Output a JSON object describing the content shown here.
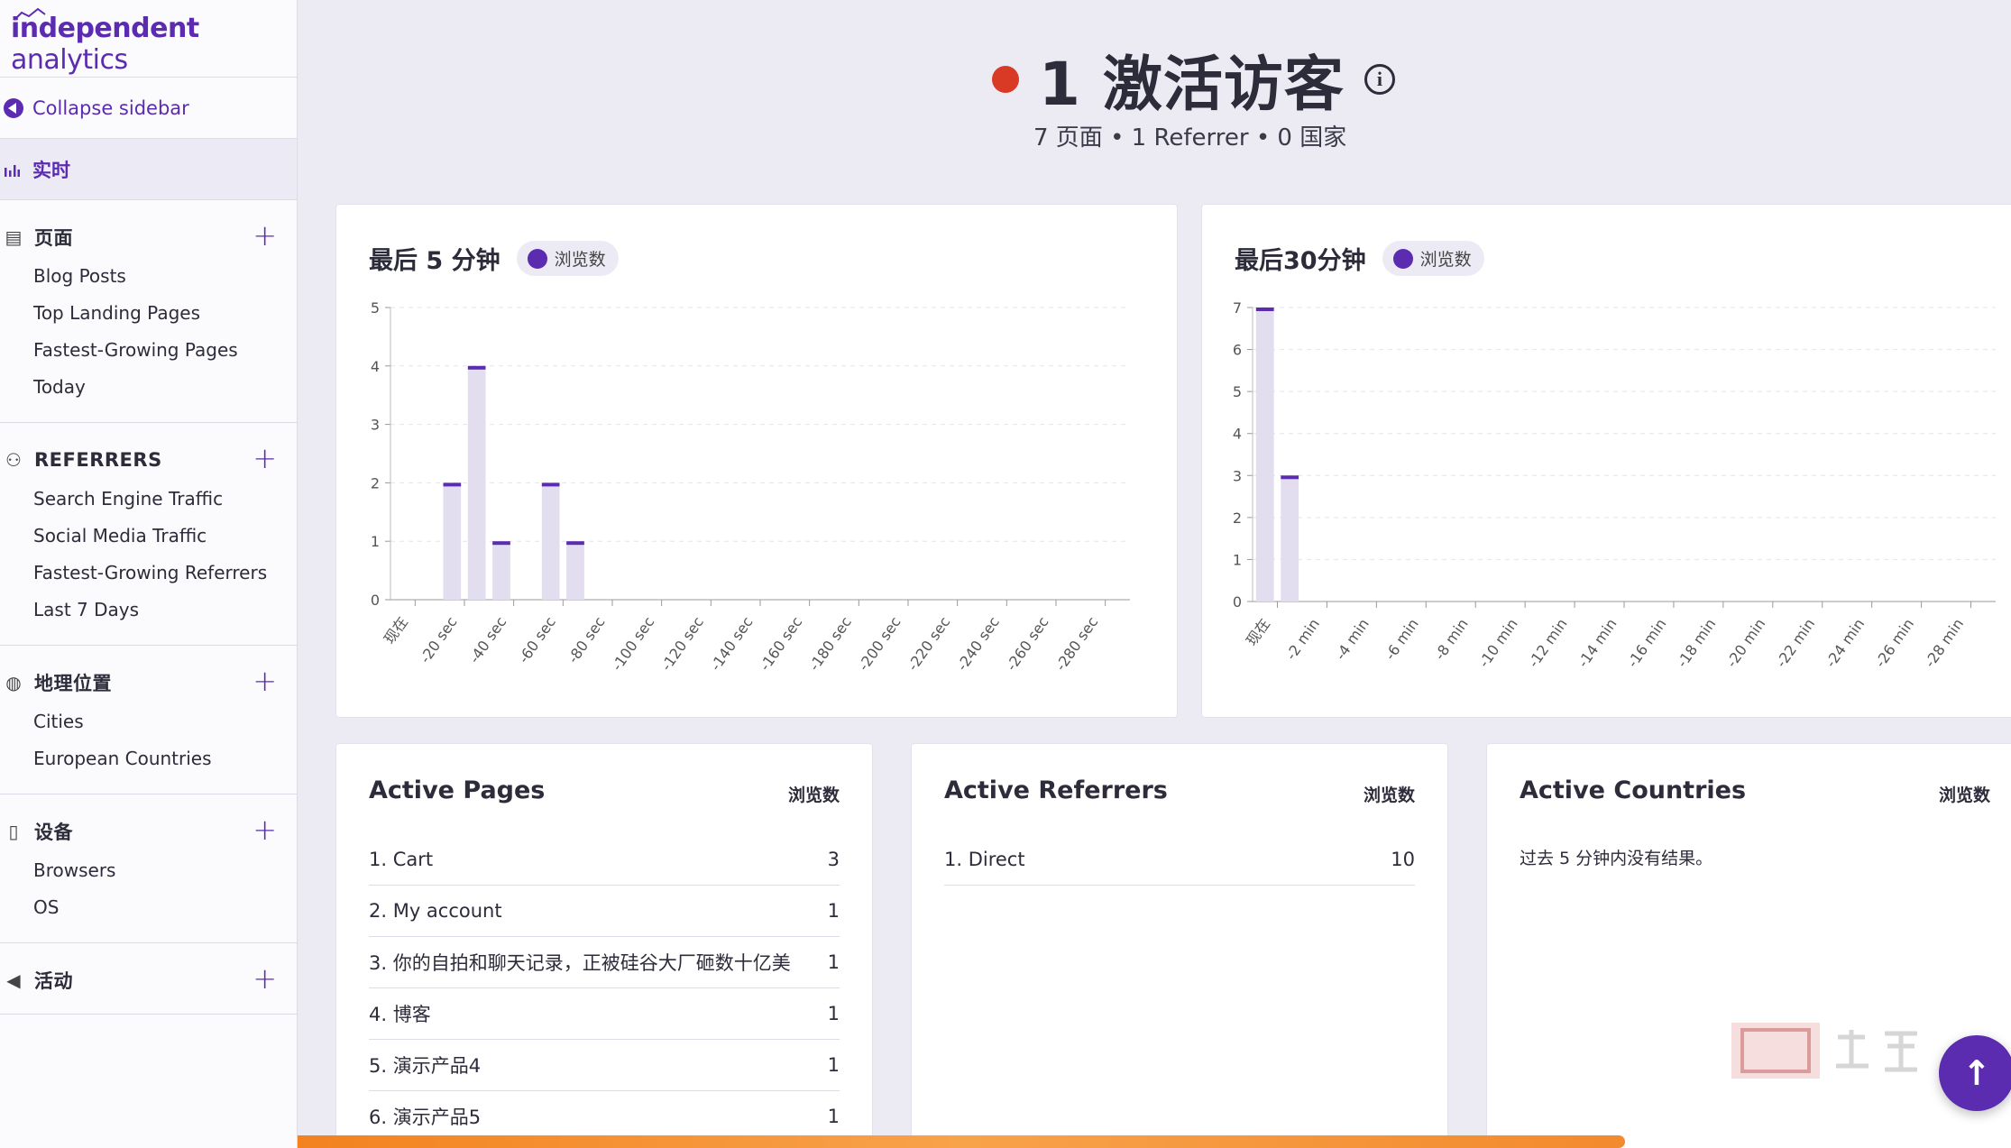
{
  "sidebar": {
    "logo": {
      "part1": "independent",
      "part2": " analytics"
    },
    "collapse_label": "Collapse sidebar",
    "realtime_label": "实时",
    "sections": [
      {
        "icon": "page-icon",
        "label": "页面",
        "items": [
          "Blog Posts",
          "Top Landing Pages",
          "Fastest-Growing Pages",
          "Today"
        ]
      },
      {
        "icon": "network-icon",
        "label": "REFERRERS",
        "items": [
          "Search Engine Traffic",
          "Social Media Traffic",
          "Fastest-Growing Referrers",
          "Last 7 Days"
        ]
      },
      {
        "icon": "globe-icon",
        "label": "地理位置",
        "items": [
          "Cities",
          "European Countries"
        ]
      },
      {
        "icon": "device-icon",
        "label": "设备",
        "items": [
          "Browsers",
          "OS"
        ]
      },
      {
        "icon": "megaphone-icon",
        "label": "活动",
        "items": []
      }
    ]
  },
  "header": {
    "title": "1 激活访客",
    "subtitle": "7 页面 • 1 Referrer • 0 国家"
  },
  "charts": {
    "legend_label": "浏览数"
  },
  "chart_data": [
    {
      "type": "bar",
      "title": "最后 5 分钟",
      "series": [
        {
          "name": "浏览数",
          "values": [
            0,
            0,
            2,
            4,
            1,
            0,
            2,
            1,
            0,
            0,
            0,
            0,
            0,
            0,
            0,
            0,
            0,
            0,
            0,
            0,
            0,
            0,
            0,
            0,
            0,
            0,
            0,
            0,
            0,
            0
          ]
        }
      ],
      "tick_labels": [
        "现在",
        "-20 sec",
        "-40 sec",
        "-60 sec",
        "-80 sec",
        "-100 sec",
        "-120 sec",
        "-140 sec",
        "-160 sec",
        "-180 sec",
        "-200 sec",
        "-220 sec",
        "-240 sec",
        "-260 sec",
        "-280 sec"
      ],
      "ylim": [
        0,
        5
      ],
      "yticks": [
        0,
        1,
        2,
        3,
        4,
        5
      ]
    },
    {
      "type": "bar",
      "title": "最后30分钟",
      "series": [
        {
          "name": "浏览数",
          "values": [
            7,
            3,
            0,
            0,
            0,
            0,
            0,
            0,
            0,
            0,
            0,
            0,
            0,
            0,
            0,
            0,
            0,
            0,
            0,
            0,
            0,
            0,
            0,
            0,
            0,
            0,
            0,
            0,
            0,
            0
          ]
        }
      ],
      "tick_labels": [
        "现在",
        "-2 min",
        "-4 min",
        "-6 min",
        "-8 min",
        "-10 min",
        "-12 min",
        "-14 min",
        "-16 min",
        "-18 min",
        "-20 min",
        "-22 min",
        "-24 min",
        "-26 min",
        "-28 min"
      ],
      "ylim": [
        0,
        7
      ],
      "yticks": [
        0,
        1,
        2,
        3,
        4,
        5,
        6,
        7
      ]
    }
  ],
  "active_pages": {
    "title": "Active Pages",
    "col": "浏览数",
    "rows": [
      {
        "name": "1. Cart",
        "value": "3"
      },
      {
        "name": "2. My account",
        "value": "1"
      },
      {
        "name": "3. 你的自拍和聊天记录，正被硅谷大厂砸数十亿美",
        "value": "1"
      },
      {
        "name": "4. 博客",
        "value": "1"
      },
      {
        "name": "5. 演示产品4",
        "value": "1"
      },
      {
        "name": "6. 演示产品5",
        "value": "1"
      }
    ]
  },
  "active_referrers": {
    "title": "Active Referrers",
    "col": "浏览数",
    "rows": [
      {
        "name": "1. Direct",
        "value": "10"
      }
    ]
  },
  "active_countries": {
    "title": "Active Countries",
    "col": "浏览数",
    "empty": "过去 5 分钟内没有结果。"
  },
  "colors": {
    "accent": "#5b2bb0",
    "bar_fill": "#e2ddef",
    "live": "#d93a26",
    "progress": "#f3821f"
  }
}
